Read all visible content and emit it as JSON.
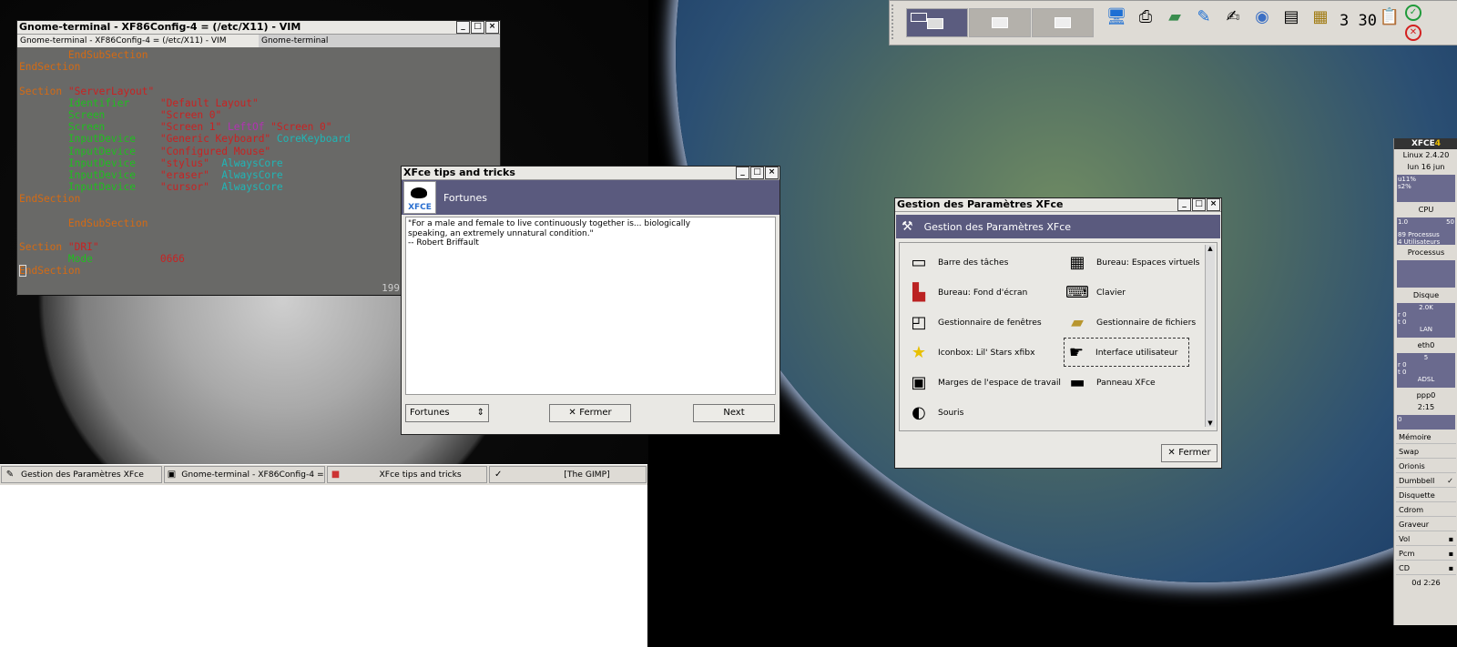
{
  "terminal": {
    "title": "Gnome-terminal - XF86Config-4 = (/etc/X11) - VIM",
    "tabs": [
      "Gnome-terminal - XF86Config-4 = (/etc/X11) - VIM",
      "Gnome-terminal"
    ],
    "lines": [
      [
        [
          "        EndSubSection",
          "o"
        ]
      ],
      [
        [
          "EndSection",
          "o"
        ]
      ],
      [
        [
          "",
          ""
        ]
      ],
      [
        [
          "Section ",
          "o"
        ],
        [
          "\"ServerLayout\"",
          "r"
        ]
      ],
      [
        [
          "        Identifier     ",
          "g"
        ],
        [
          "\"Default Layout\"",
          "r"
        ]
      ],
      [
        [
          "        Screen         ",
          "g"
        ],
        [
          "\"Screen 0\"",
          "r"
        ]
      ],
      [
        [
          "        Screen         ",
          "g"
        ],
        [
          "\"Screen 1\" ",
          "r"
        ],
        [
          "LeftOf ",
          "m"
        ],
        [
          "\"Screen 0\"",
          "r"
        ]
      ],
      [
        [
          "        InputDevice    ",
          "g"
        ],
        [
          "\"Generic Keyboard\" ",
          "r"
        ],
        [
          "CoreKeyboard",
          "c"
        ]
      ],
      [
        [
          "        InputDevice    ",
          "g"
        ],
        [
          "\"Configured Mouse\"",
          "r"
        ]
      ],
      [
        [
          "        InputDevice    ",
          "g"
        ],
        [
          "\"stylus\"  ",
          "r"
        ],
        [
          "AlwaysCore",
          "c"
        ]
      ],
      [
        [
          "        InputDevice    ",
          "g"
        ],
        [
          "\"eraser\"  ",
          "r"
        ],
        [
          "AlwaysCore",
          "c"
        ]
      ],
      [
        [
          "        InputDevice    ",
          "g"
        ],
        [
          "\"cursor\"  ",
          "r"
        ],
        [
          "AlwaysCore",
          "c"
        ]
      ],
      [
        [
          "EndSection",
          "o"
        ]
      ],
      [
        [
          "",
          ""
        ]
      ],
      [
        [
          "        EndSubSection",
          "o"
        ]
      ],
      [
        [
          "",
          ""
        ]
      ],
      [
        [
          "Section ",
          "o"
        ],
        [
          "\"DRI\"",
          "r"
        ]
      ],
      [
        [
          "        Mode           ",
          "g"
        ],
        [
          "0666",
          "r"
        ]
      ],
      [
        [
          "EndSection",
          "o"
        ]
      ]
    ],
    "status_right": "199"
  },
  "tips": {
    "title": "XFce tips and tricks",
    "banner_title": "Fortunes",
    "logo_text": "XFCE",
    "fortune_lines": [
      "\"For a male and female to live continuously together is...  biologically",
      "speaking, an extremely unnatural condition.\"",
      "-- Robert Briffault"
    ],
    "select_value": "Fortunes",
    "close_label": "Fermer",
    "next_label": "Next"
  },
  "settings": {
    "title": "Gestion des Paramètres XFce",
    "banner_title": "Gestion des Paramètres XFce",
    "items": [
      {
        "label": "Barre des tâches",
        "icon": "taskbar-icon"
      },
      {
        "label": "Bureau: Espaces virtuels",
        "icon": "virtual-desktops-icon"
      },
      {
        "label": "Bureau: Fond d'écran",
        "icon": "wallpaper-icon"
      },
      {
        "label": "Clavier",
        "icon": "keyboard-icon"
      },
      {
        "label": "Gestionnaire de fenêtres",
        "icon": "window-manager-icon"
      },
      {
        "label": "Gestionnaire de fichiers",
        "icon": "folder-icon"
      },
      {
        "label": "Iconbox: Lil' Stars xfibx",
        "icon": "star-icon"
      },
      {
        "label": "Interface utilisateur",
        "icon": "user-interface-icon"
      },
      {
        "label": "Marges de l'espace de travail",
        "icon": "workspace-margins-icon"
      },
      {
        "label": "Panneau XFce",
        "icon": "panel-icon"
      },
      {
        "label": "Souris",
        "icon": "mouse-icon"
      }
    ],
    "close_label": "Fermer"
  },
  "taskbar": {
    "tasks": [
      {
        "label": "Gestion des Paramètres XFce",
        "icon": "settings-icon"
      },
      {
        "label": "Gnome-terminal - XF86Config-4 = (/et",
        "icon": "terminal-icon"
      },
      {
        "label": "XFce tips and tricks",
        "icon": "tips-icon"
      },
      {
        "label": "[The GIMP]",
        "icon": "gimp-icon"
      }
    ]
  },
  "top_panel": {
    "clock": "3 30",
    "icons": [
      "monitor-icon",
      "printer-icon",
      "folder-icon",
      "paint-icon",
      "notes-icon",
      "globe-icon",
      "terminal-icon",
      "calendar-icon",
      "clipboard-icon"
    ],
    "ok_color": "#1f9a3a",
    "cancel_color": "#d22020"
  },
  "right_panel": {
    "brand": "XFCE",
    "brand_version": "4",
    "kernel": "Linux 2.4.20",
    "date": "lun 16 jun",
    "cpu_graph_text": [
      "u11%",
      "s2%"
    ],
    "cpu_label": "CPU",
    "cpu_scale": [
      "1.0",
      "50"
    ],
    "cpu_procs": [
      "89 Processus",
      "4 Utilisateurs"
    ],
    "process_label": "Processus",
    "disk_label": "Disque",
    "disk_value": "2.0K",
    "disk_io": [
      "r 0",
      "t 0"
    ],
    "lan_label": "LAN",
    "eth_label": "eth0",
    "eth_value": "5",
    "eth_io": [
      "r 0",
      "t 0"
    ],
    "adsl_label": "ADSL",
    "ppp_label": "ppp0",
    "ppp_time": "2:15",
    "ppp_value": "0",
    "buttons": [
      "Mémoire",
      "Swap",
      "Orionis",
      "Dumbbell",
      "Disquette",
      "Cdrom",
      "Graveur"
    ],
    "mixer": [
      "Vol",
      "Pcm",
      "CD"
    ],
    "uptime": "0d 2:26"
  }
}
